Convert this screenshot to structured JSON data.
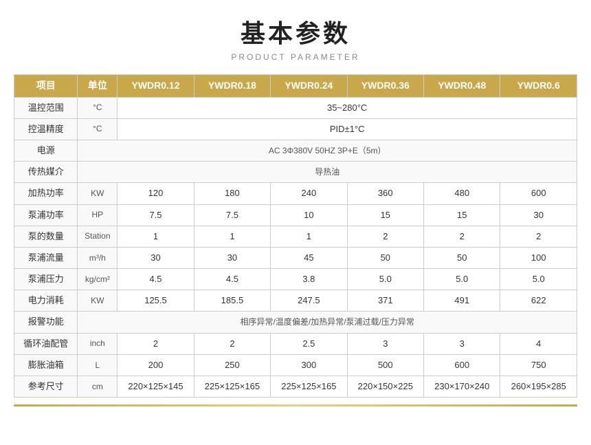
{
  "title": "基本参数",
  "subtitle": "PRODUCT PARAMETER",
  "table": {
    "headers": [
      "项目",
      "单位",
      "YWDR0.12",
      "YWDR0.18",
      "YWDR0.24",
      "YWDR0.36",
      "YWDR0.48",
      "YWDR0.6"
    ],
    "rows": [
      {
        "label": "温控范围",
        "unit": "°C",
        "merged": true,
        "mergedValue": "35~280°C",
        "mergedSpan": 6
      },
      {
        "label": "控温精度",
        "unit": "°C",
        "merged": true,
        "mergedValue": "PID±1°C",
        "mergedSpan": 6
      },
      {
        "label": "电源",
        "unit": "",
        "merged": true,
        "mergedValue": "AC 3Φ380V 50HZ 3P+E（5m）",
        "mergedSpan": 7
      },
      {
        "label": "传热媒介",
        "unit": "",
        "merged": true,
        "mergedValue": "导热油",
        "mergedSpan": 7
      },
      {
        "label": "加热功率",
        "unit": "KW",
        "merged": false,
        "values": [
          "120",
          "180",
          "240",
          "360",
          "480",
          "600"
        ]
      },
      {
        "label": "泵浦功率",
        "unit": "HP",
        "merged": false,
        "values": [
          "7.5",
          "7.5",
          "10",
          "15",
          "15",
          "30"
        ]
      },
      {
        "label": "泵的数量",
        "unit": "Station",
        "merged": false,
        "values": [
          "1",
          "1",
          "1",
          "2",
          "2",
          "2"
        ]
      },
      {
        "label": "泵浦流量",
        "unit": "m³/h",
        "merged": false,
        "values": [
          "30",
          "30",
          "45",
          "50",
          "50",
          "100"
        ]
      },
      {
        "label": "泵浦压力",
        "unit": "kg/cm²",
        "merged": false,
        "values": [
          "4.5",
          "4.5",
          "3.8",
          "5.0",
          "5.0",
          "5.0"
        ]
      },
      {
        "label": "电力消耗",
        "unit": "KW",
        "merged": false,
        "values": [
          "125.5",
          "185.5",
          "247.5",
          "371",
          "491",
          "622"
        ]
      },
      {
        "label": "报警功能",
        "unit": "",
        "merged": true,
        "mergedValue": "相序异常/温度偏差/加热异常/泵浦过载/压力异常",
        "mergedSpan": 7
      },
      {
        "label": "循环油配管",
        "unit": "inch",
        "merged": false,
        "values": [
          "2",
          "2",
          "2.5",
          "3",
          "3",
          "4"
        ]
      },
      {
        "label": "膨胀油箱",
        "unit": "L",
        "merged": false,
        "values": [
          "200",
          "250",
          "300",
          "500",
          "600",
          "750"
        ]
      },
      {
        "label": "参考尺寸",
        "unit": "cm",
        "merged": false,
        "values": [
          "220×125×145",
          "225×125×165",
          "225×125×165",
          "220×150×225",
          "230×170×240",
          "260×195×285"
        ]
      }
    ]
  }
}
